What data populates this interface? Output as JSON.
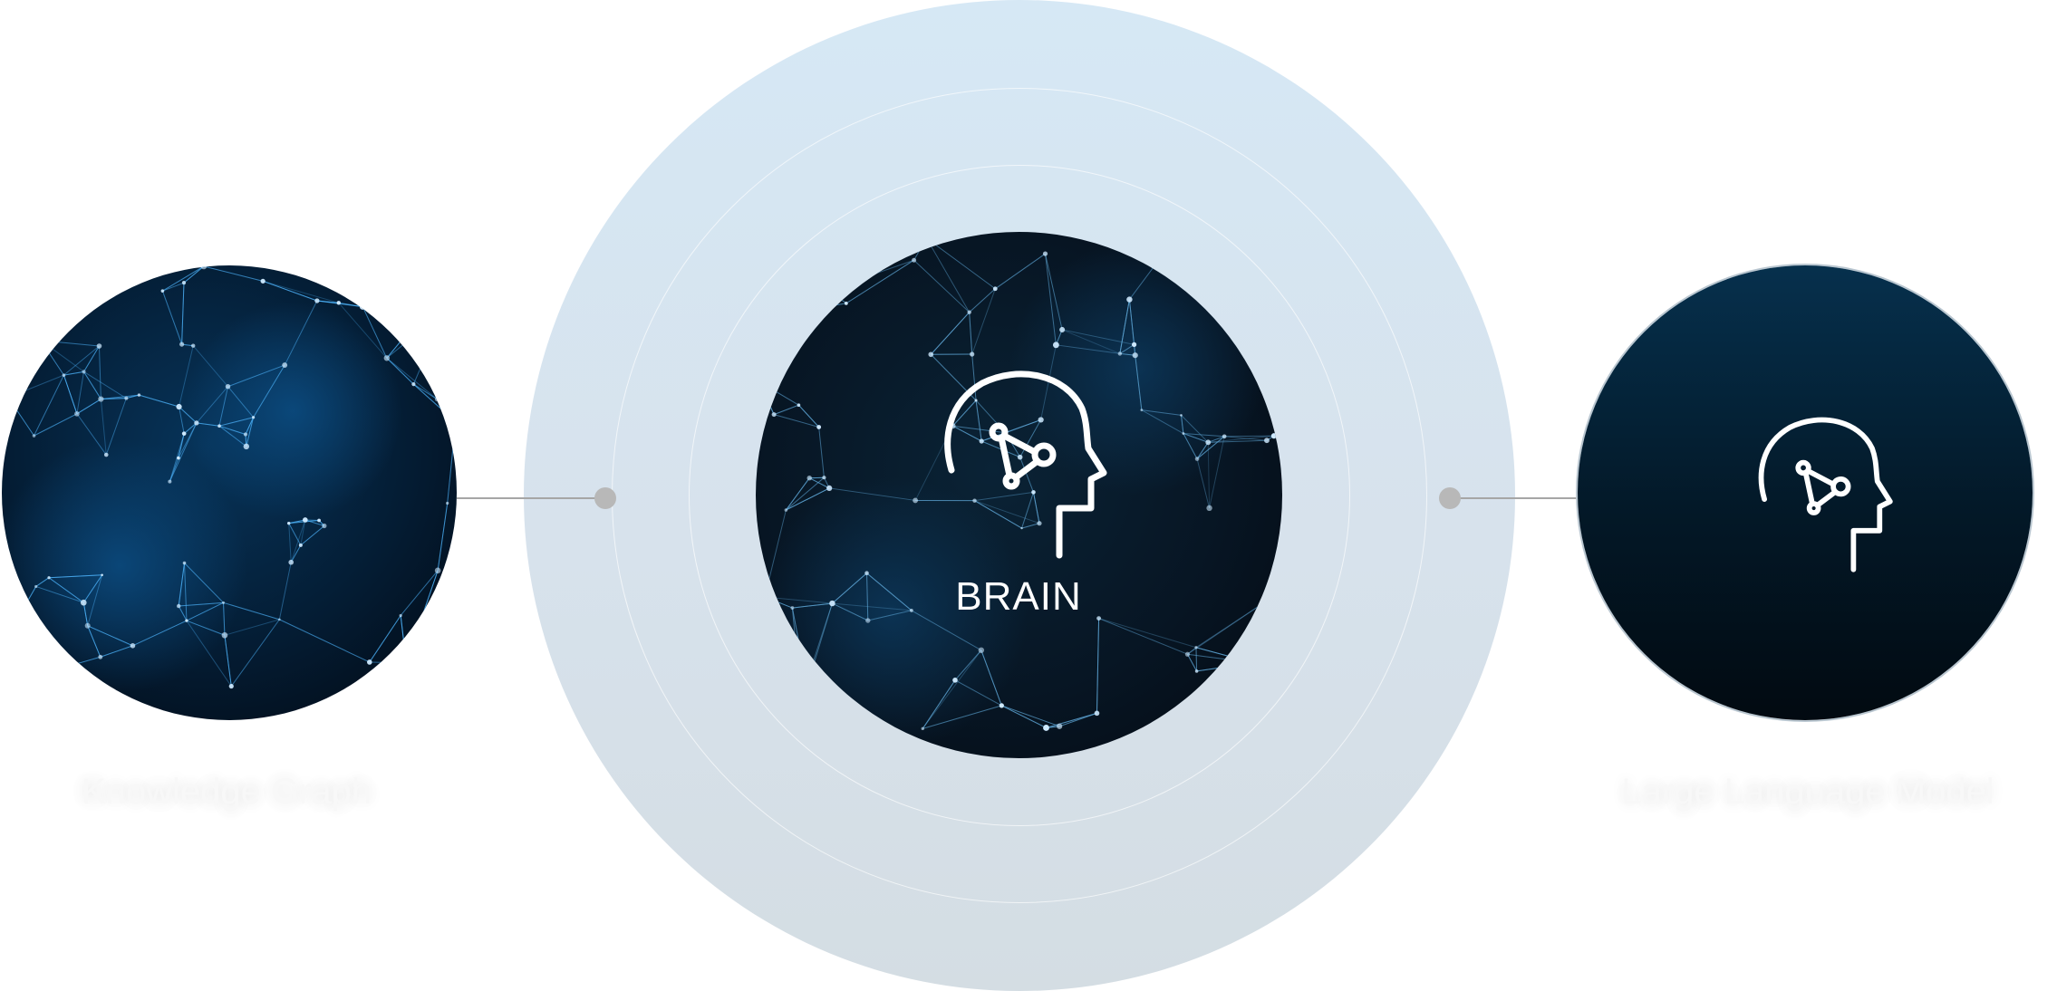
{
  "nodes": {
    "knowledge_graph": {
      "caption": "Knowledge Graph"
    },
    "brain": {
      "label": "BRAIN"
    },
    "large_language_model": {
      "caption": "Large Language Model"
    }
  },
  "colors": {
    "halo_top": "#d6e8f5",
    "halo_bottom": "#d4dde3",
    "node_dark": "#041624",
    "network_accent": "#4fb7ff",
    "connector": "#a6a6a6",
    "icon": "#ffffff"
  },
  "icons": {
    "brain_node": "head-network-icon",
    "llm_node": "head-network-icon"
  }
}
